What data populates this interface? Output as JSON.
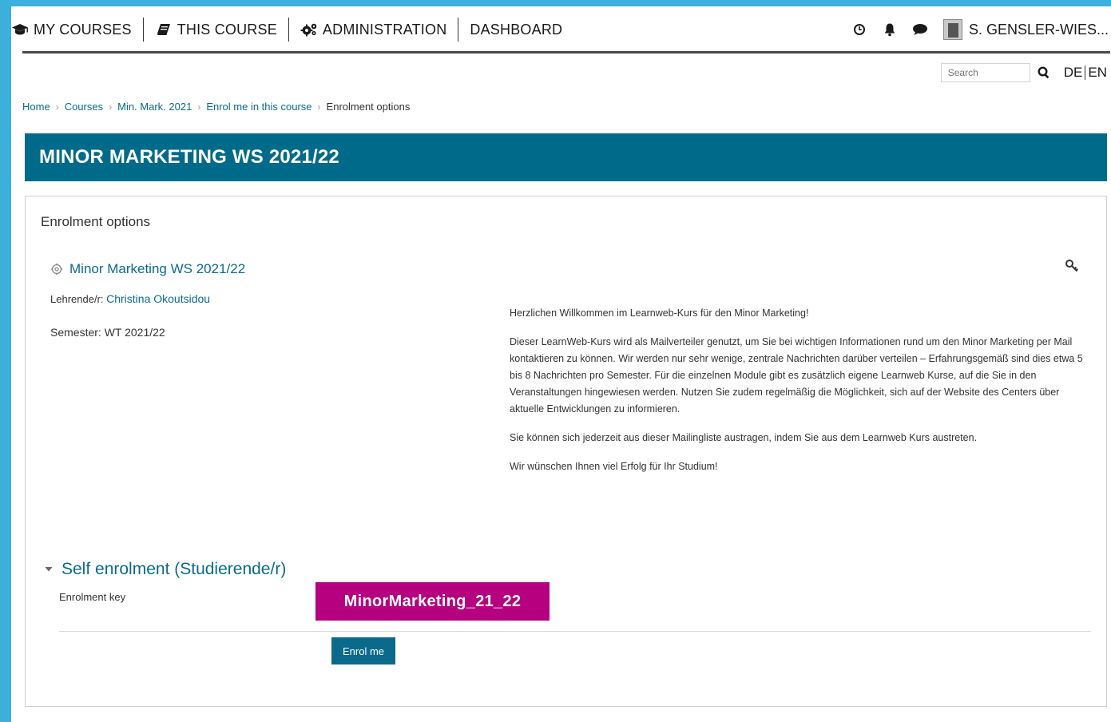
{
  "nav": {
    "my_courses": "MY COURSES",
    "this_course": "THIS COURSE",
    "administration": "ADMINISTRATION",
    "dashboard": "DASHBOARD",
    "user_name": "S. GENSLER-WIES..."
  },
  "search": {
    "placeholder": "Search"
  },
  "lang": {
    "de": "DE",
    "en": "EN"
  },
  "breadcrumb": [
    "Home",
    "Courses",
    "Min. Mark. 2021",
    "Enrol me in this course",
    "Enrolment options"
  ],
  "banner": {
    "title": "MINOR MARKETING WS 2021/22"
  },
  "main": {
    "section_title": "Enrolment options",
    "course_name": "Minor Marketing WS 2021/22",
    "teacher_label": "Lehrende/r:",
    "teacher_name": "Christina Okoutsidou",
    "semester": "Semester:  WT 2021/22",
    "summary": [
      "Herzlichen Willkommen im Learnweb-Kurs für den Minor Marketing!",
      "Dieser LearnWeb-Kurs wird als Mailverteiler genutzt, um Sie bei wichtigen Informationen rund um den Minor Marketing per Mail kontaktieren zu können. Wir werden nur sehr wenige, zentrale Nachrichten darüber verteilen – Erfahrungsgemäß sind dies etwa 5 bis 8 Nachrichten pro Semester. Für die einzelnen Module gibt es zusätzlich eigene Learnweb Kurse, auf die Sie in den Veranstaltungen hingewiesen werden. Nutzen Sie zudem regelmäßig die Möglichkeit, sich auf der Website des Centers über aktuelle Entwicklungen zu informieren.",
      "Sie können sich jederzeit aus dieser Mailingliste austragen, indem Sie aus dem Learnweb Kurs austreten.",
      "Wir wünschen Ihnen viel Erfolg für Ihr Studium!"
    ],
    "self_enrolment_title": "Self enrolment (Studierende/r)",
    "enrolment_key_label": "Enrolment key",
    "enrolment_key_value": "MinorMarketing_21_22",
    "enrol_button": "Enrol me"
  },
  "colors": {
    "frame": "#3bb0dc",
    "banner": "#006a8a",
    "link": "#0b6a8c",
    "key_highlight": "#b5007f"
  },
  "icons": [
    "graduation-cap-icon",
    "book-icon",
    "cogs-icon",
    "clock-icon",
    "bell-icon",
    "chat-icon",
    "search-icon",
    "course-icon",
    "key-icon",
    "caret-down-icon"
  ]
}
